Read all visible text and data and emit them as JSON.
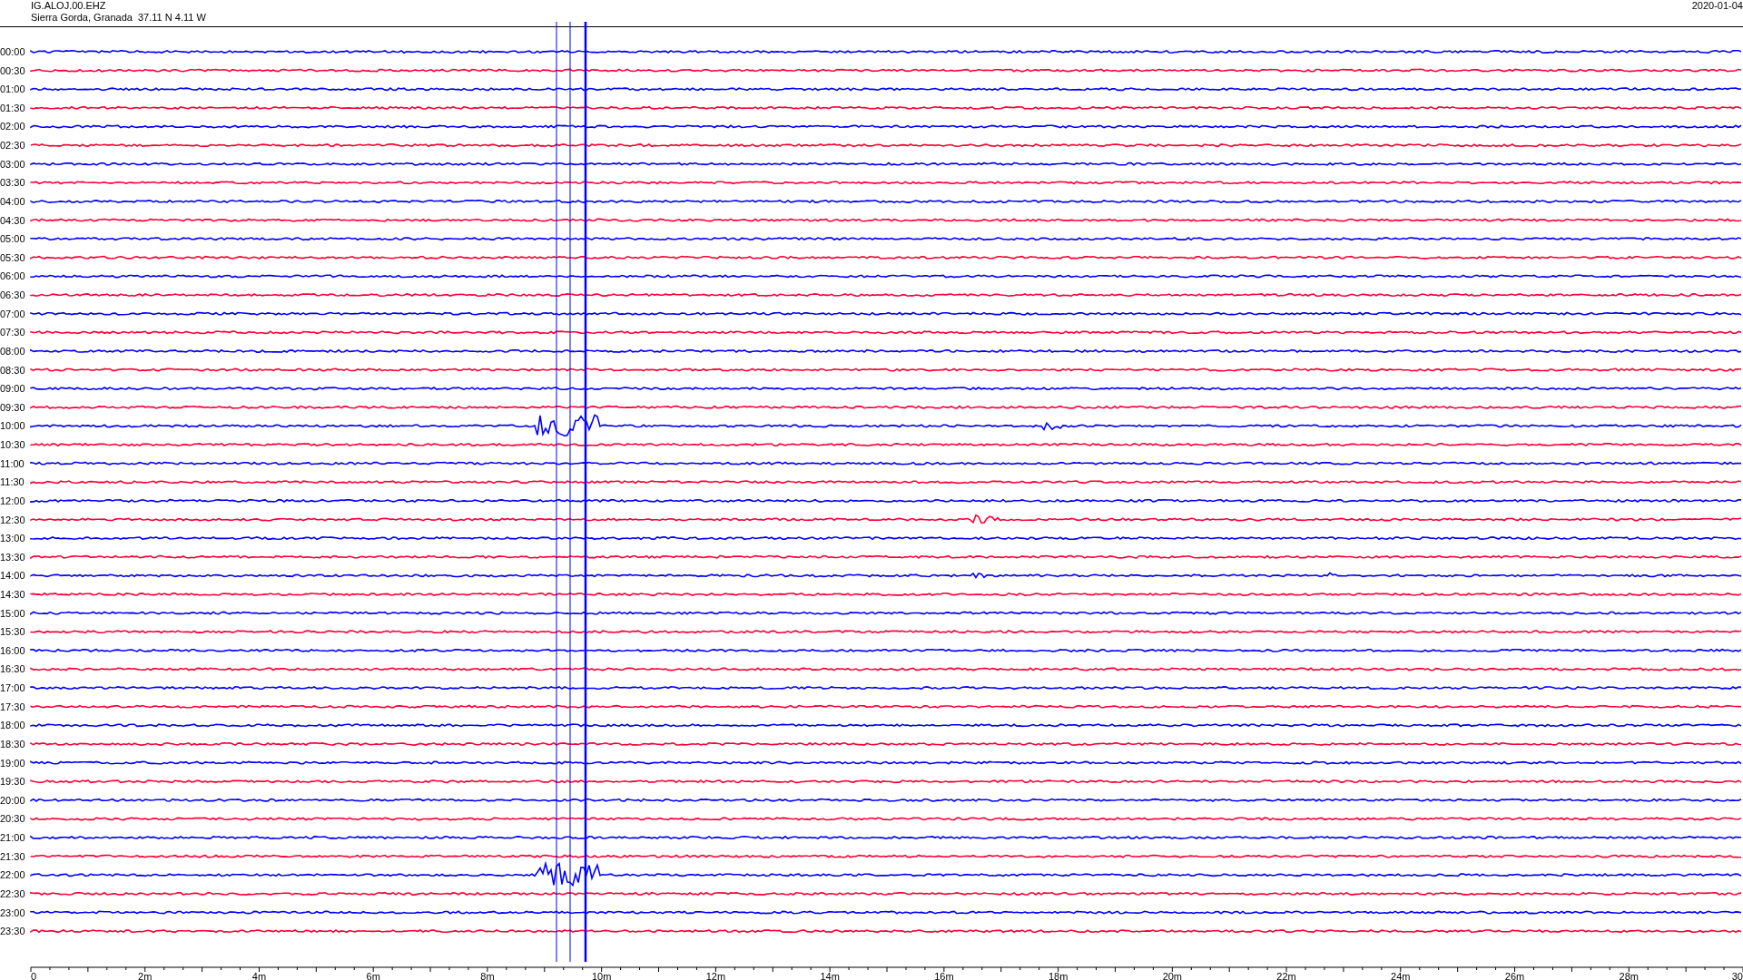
{
  "header": {
    "station": "IG.ALOJ.00.EHZ",
    "location": "Sierra Gorda, Granada  37.11 N 4.11 W",
    "date": "2020-01-04"
  },
  "traces": [
    {
      "label": "00:00",
      "color": "#0000ff"
    },
    {
      "label": "00:30",
      "color": "#ff0033"
    },
    {
      "label": "01:00",
      "color": "#0000ff"
    },
    {
      "label": "01:30",
      "color": "#ff0033"
    },
    {
      "label": "02:00",
      "color": "#0000ff"
    },
    {
      "label": "02:30",
      "color": "#ff0033"
    },
    {
      "label": "03:00",
      "color": "#0000ff"
    },
    {
      "label": "03:30",
      "color": "#ff0033"
    },
    {
      "label": "04:00",
      "color": "#0000ff"
    },
    {
      "label": "04:30",
      "color": "#ff0033"
    },
    {
      "label": "05:00",
      "color": "#0000ff"
    },
    {
      "label": "05:30",
      "color": "#ff0033"
    },
    {
      "label": "06:00",
      "color": "#0000ff"
    },
    {
      "label": "06:30",
      "color": "#ff0033"
    },
    {
      "label": "07:00",
      "color": "#0000ff"
    },
    {
      "label": "07:30",
      "color": "#ff0033"
    },
    {
      "label": "08:00",
      "color": "#0000ff"
    },
    {
      "label": "08:30",
      "color": "#ff0033"
    },
    {
      "label": "09:00",
      "color": "#0000ff"
    },
    {
      "label": "09:30",
      "color": "#ff0033"
    },
    {
      "label": "10:00",
      "color": "#0000ff"
    },
    {
      "label": "10:30",
      "color": "#ff0033"
    },
    {
      "label": "11:00",
      "color": "#0000ff"
    },
    {
      "label": "11:30",
      "color": "#ff0033"
    },
    {
      "label": "12:00",
      "color": "#0000ff"
    },
    {
      "label": "12:30",
      "color": "#ff0033"
    },
    {
      "label": "13:00",
      "color": "#0000ff"
    },
    {
      "label": "13:30",
      "color": "#ff0033"
    },
    {
      "label": "14:00",
      "color": "#0000ff"
    },
    {
      "label": "14:30",
      "color": "#ff0033"
    },
    {
      "label": "15:00",
      "color": "#0000ff"
    },
    {
      "label": "15:30",
      "color": "#ff0033"
    },
    {
      "label": "16:00",
      "color": "#0000ff"
    },
    {
      "label": "16:30",
      "color": "#ff0033"
    },
    {
      "label": "17:00",
      "color": "#0000ff"
    },
    {
      "label": "17:30",
      "color": "#ff0033"
    },
    {
      "label": "18:00",
      "color": "#0000ff"
    },
    {
      "label": "18:30",
      "color": "#ff0033"
    },
    {
      "label": "19:00",
      "color": "#0000ff"
    },
    {
      "label": "19:30",
      "color": "#ff0033"
    },
    {
      "label": "20:00",
      "color": "#0000ff"
    },
    {
      "label": "20:30",
      "color": "#ff0033"
    },
    {
      "label": "21:00",
      "color": "#0000ff"
    },
    {
      "label": "21:30",
      "color": "#ff0033"
    },
    {
      "label": "22:00",
      "color": "#0000ff"
    },
    {
      "label": "22:30",
      "color": "#ff0033"
    },
    {
      "label": "23:00",
      "color": "#0000ff"
    },
    {
      "label": "23:30",
      "color": "#ff0033"
    }
  ],
  "time_axis": {
    "labels": [
      "0",
      "2m",
      "4m",
      "6m",
      "8m",
      "10m",
      "12m",
      "14m",
      "16m",
      "18m",
      "20m",
      "22m",
      "24m",
      "26m",
      "28m",
      "30"
    ]
  }
}
